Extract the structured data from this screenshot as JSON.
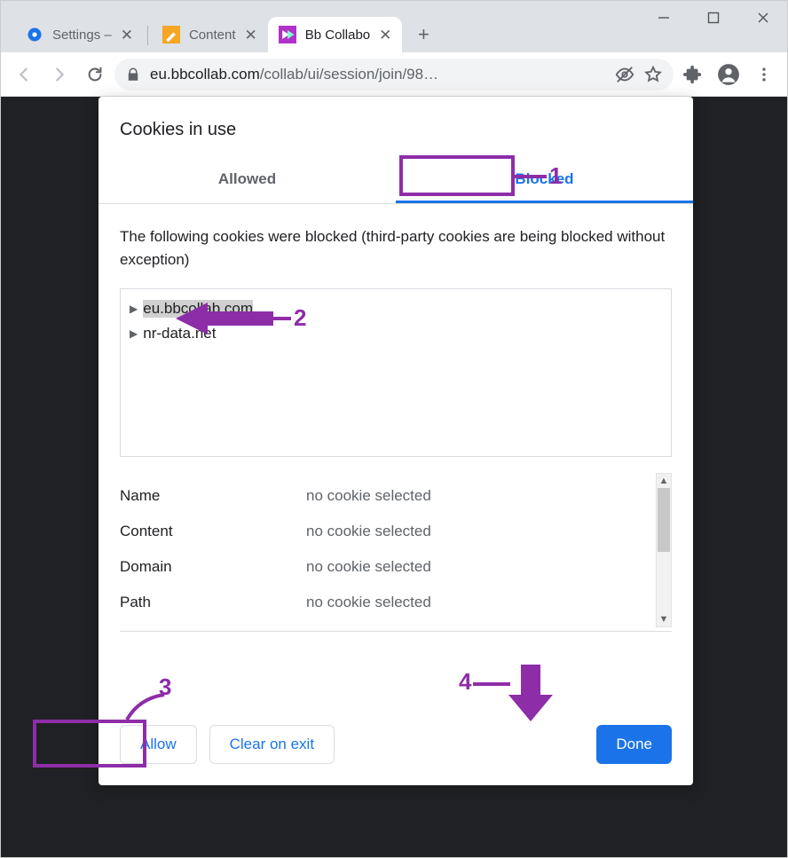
{
  "window": {
    "tabs": [
      {
        "title": "Settings –",
        "favicon": "gear-blue",
        "active": false
      },
      {
        "title": "Content",
        "favicon": "pencil-orange",
        "active": false
      },
      {
        "title": "Bb Collabo",
        "favicon": "bb-purple",
        "active": true
      }
    ]
  },
  "toolbar": {
    "url_host": "eu.bbcollab.com",
    "url_path": "/collab/ui/session/join/98…"
  },
  "dialog": {
    "title": "Cookies in use",
    "tabs": {
      "allowed": "Allowed",
      "blocked": "Blocked"
    },
    "active_tab": "blocked",
    "description": "The following cookies were blocked (third-party cookies are being blocked without exception)",
    "domains": [
      {
        "name": "eu.bbcollab.com",
        "selected": true
      },
      {
        "name": "nr-data.net",
        "selected": false
      }
    ],
    "details": {
      "labels": {
        "name": "Name",
        "content": "Content",
        "domain": "Domain",
        "path": "Path"
      },
      "values": {
        "name": "no cookie selected",
        "content": "no cookie selected",
        "domain": "no cookie selected",
        "path": "no cookie selected"
      }
    },
    "buttons": {
      "allow": "Allow",
      "clear": "Clear on exit",
      "done": "Done"
    }
  },
  "annotations": {
    "n1": "1",
    "n2": "2",
    "n3": "3",
    "n4": "4"
  }
}
